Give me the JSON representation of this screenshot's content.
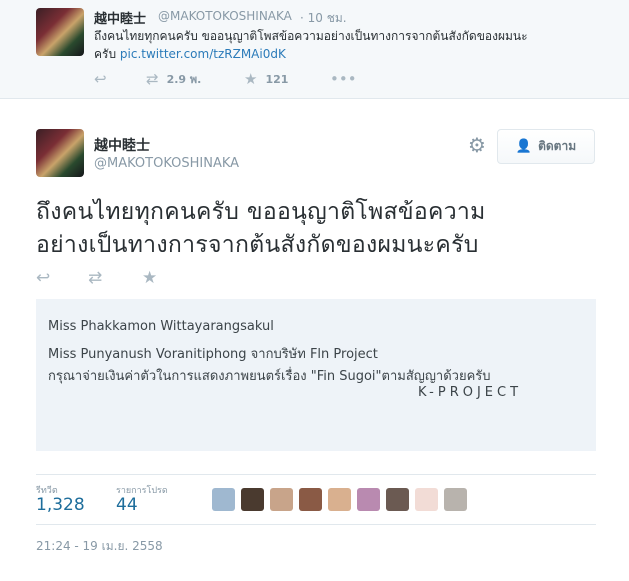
{
  "reply": {
    "name": "越中睦士",
    "handle": "@MAKOTOKOSHINAKA",
    "time": "· 10 ชม.",
    "text": "ถึงคนไทยทุกคนครับ ขออนุญาติโพสข้อความอย่างเป็นทางการจากต้นสังกัดของผมนะ",
    "text2": "ครับ",
    "link": "pic.twitter.com/tzRZMAi0dK",
    "retweets": "2.9 พ.",
    "favorites": "121"
  },
  "tweet": {
    "name": "越中睦士",
    "handle": "@MAKOTOKOSHINAKA",
    "follow_label": "ติดตาม",
    "line1": "ถึงคนไทยทุกคนครับ ขออนุญาติโพสข้อความ",
    "line2": "อย่างเป็นทางการจากต้นสังกัดของผมนะครับ"
  },
  "card": {
    "line1": "Miss Phakkamon Wittayarangsakul",
    "line2": "Miss Punyanush Voranitiphong จากบริษัท Fln Project",
    "line3": "กรุณาจ่ายเงินค่าตัวในการแสดงภาพยนตร์เรื่อง \"Fin Sugoi\"ตามสัญญาด้วยครับ",
    "sign": "K-PROJECT"
  },
  "stats": {
    "retweets_label": "รีทวีต",
    "retweets": "1,328",
    "favorites_label": "รายการโปรด",
    "favorites": "44"
  },
  "date": "21:24 - 19 เม.ย. 2558",
  "icons": {
    "reply": "reply-icon",
    "retweet": "retweet-icon",
    "favorite": "star-icon",
    "more": "more-icon",
    "gear": "gear-icon",
    "follow": "add-user-icon"
  },
  "colors": {
    "link": "#2b7bb9",
    "stat_value": "#1d6d9b",
    "follow_icon": "#3b94d9"
  }
}
